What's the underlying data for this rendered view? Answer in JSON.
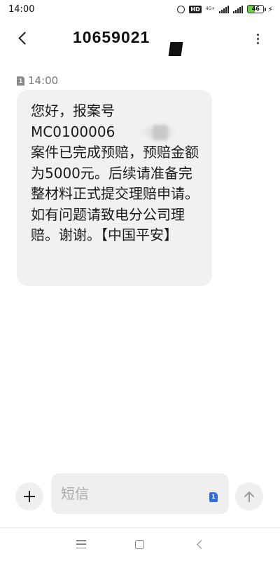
{
  "status_bar": {
    "time": "14:00",
    "hd_label": "HD",
    "network_label": "4G+",
    "battery_level": "46"
  },
  "header": {
    "contact": "10659021",
    "back_icon": "chevron-left-icon",
    "more_icon": "more-vertical-icon"
  },
  "message": {
    "timestamp": "14:00",
    "sim_label": "1",
    "body": "您好，报案号\nMC0100006\n案件已完成预赔，预赔金额为5000元。后续请准备完整材料正式提交理赔申请。如有问题请致电分公司理赔。谢谢。【中国平安】"
  },
  "composer": {
    "placeholder": "短信",
    "sim_label": "1",
    "add_icon": "plus-icon",
    "send_icon": "arrow-up-icon"
  },
  "nav": {
    "menu_icon": "menu-icon",
    "home_icon": "square-home-icon",
    "back_icon": "triangle-back-icon"
  },
  "colors": {
    "bubble": "#f1f1f1",
    "sim_badge": "#2f6fe0",
    "battery": "#6fcf4a"
  }
}
